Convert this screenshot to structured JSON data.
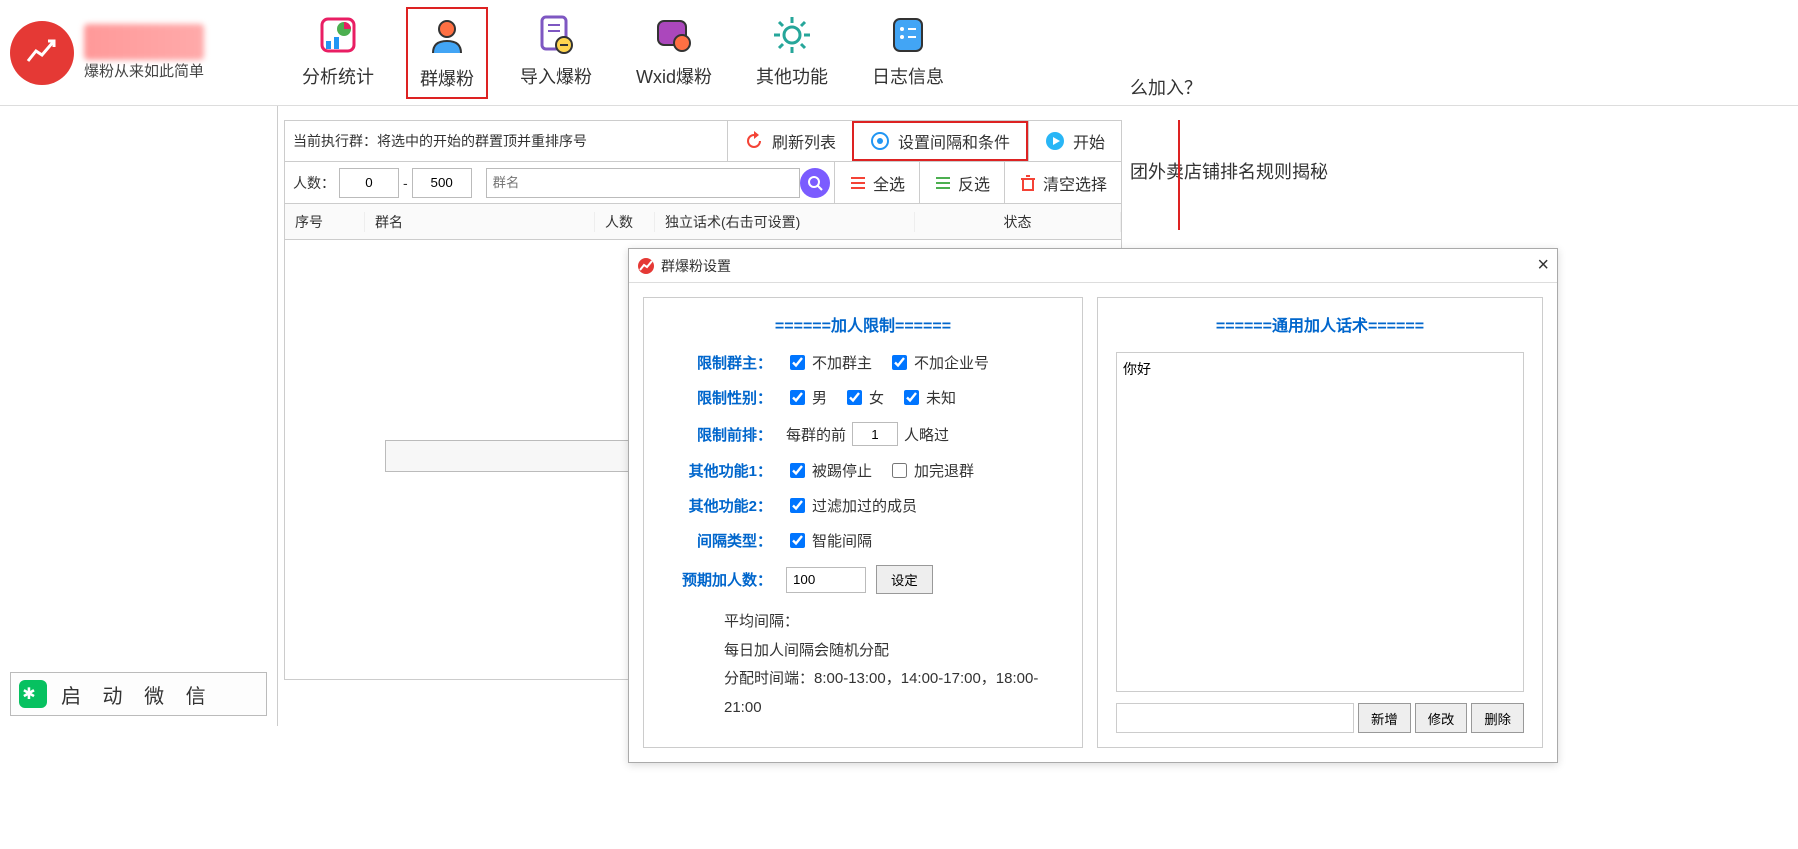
{
  "logo": {
    "sub": "爆粉从来如此简单"
  },
  "tools": {
    "analyze": "分析统计",
    "group": "群爆粉",
    "import": "导入爆粉",
    "wxid": "Wxid爆粉",
    "other": "其他功能",
    "log": "日志信息"
  },
  "bg_text1": "么加入？",
  "bg_text2": "团外卖店铺排名规则揭秘",
  "row1": {
    "label": "当前执行群：将选中的开始的群置顶并重排序号",
    "refresh": "刷新列表",
    "settings": "设置间隔和条件",
    "start": "开始"
  },
  "row2": {
    "count_label": "人数：",
    "min": "0",
    "max": "500",
    "name_ph": "群名",
    "sel_all": "全选",
    "sel_inv": "反选",
    "sel_clr": "清空选择"
  },
  "table": {
    "seq": "序号",
    "name": "群名",
    "cnt": "人数",
    "script": "独立话术(右击可设置)",
    "status": "状态"
  },
  "start_wx": "启 动 微 信",
  "dialog": {
    "title": "群爆粉设置",
    "sec1": "======加人限制======",
    "sec2": "======通用加人话术======",
    "limit_owner_label": "限制群主：",
    "no_owner": "不加群主",
    "no_corp": "不加企业号",
    "limit_gender_label": "限制性别：",
    "male": "男",
    "female": "女",
    "unknown": "未知",
    "limit_front_label": "限制前排：",
    "front_prefix": "每群的前",
    "front_value": "1",
    "front_suffix": "人略过",
    "other1_label": "其他功能1：",
    "kicked_stop": "被踢停止",
    "done_leave": "加完退群",
    "other2_label": "其他功能2：",
    "filter_added": "过滤加过的成员",
    "interval_label": "间隔类型：",
    "smart_interval": "智能间隔",
    "expect_label": "预期加人数：",
    "expect_value": "100",
    "set_btn": "设定",
    "avg_label": "平均间隔：",
    "daily_random": "每日加人间隔会随机分配",
    "time_slots": "分配时间端：8:00-13:00，14:00-17:00，18:00-21:00",
    "script_text": "你好",
    "add": "新增",
    "edit": "修改",
    "del": "删除"
  }
}
